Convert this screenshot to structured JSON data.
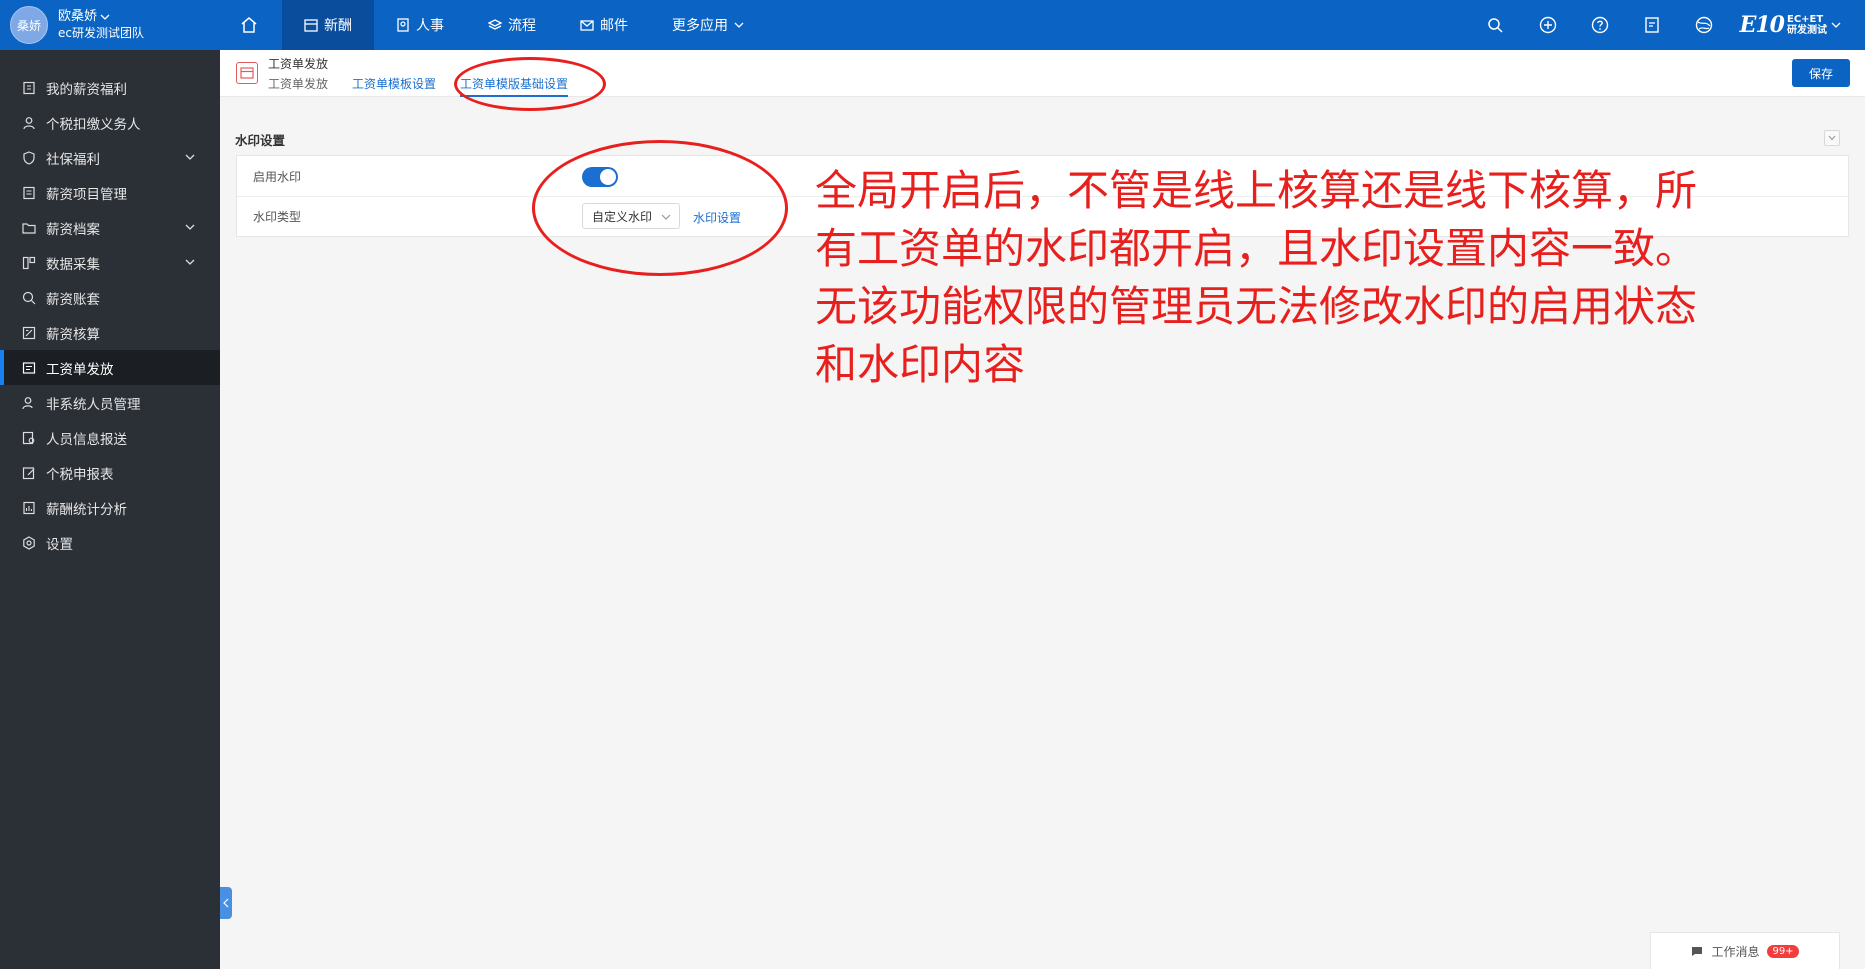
{
  "user": {
    "avatar_text": "桑娇",
    "name": "欧桑娇",
    "team": "ec研发测试团队"
  },
  "nav": {
    "items": [
      {
        "label": "新酬"
      },
      {
        "label": "人事"
      },
      {
        "label": "流程"
      },
      {
        "label": "邮件"
      },
      {
        "label": "更多应用"
      }
    ]
  },
  "brand": {
    "logo": "E10",
    "line1": "EC+ET",
    "line2": "研发测试"
  },
  "sidebar": {
    "items": [
      {
        "label": "我的薪资福利"
      },
      {
        "label": "个税扣缴义务人"
      },
      {
        "label": "社保福利"
      },
      {
        "label": "薪资项目管理"
      },
      {
        "label": "薪资档案"
      },
      {
        "label": "数据采集"
      },
      {
        "label": "薪资账套"
      },
      {
        "label": "薪资核算"
      },
      {
        "label": "工资单发放"
      },
      {
        "label": "非系统人员管理"
      },
      {
        "label": "人员信息报送"
      },
      {
        "label": "个税申报表"
      },
      {
        "label": "薪酬统计分析"
      },
      {
        "label": "设置"
      }
    ]
  },
  "header": {
    "title": "工资单发放",
    "tabs": [
      {
        "label": "工资单发放"
      },
      {
        "label": "工资单模板设置"
      },
      {
        "label": "工资单模版基础设置"
      }
    ],
    "save_label": "保存"
  },
  "section": {
    "title": "水印设置",
    "enable_label": "启用水印",
    "enable_value": true,
    "type_label": "水印类型",
    "type_value": "自定义水印",
    "settings_link": "水印设置"
  },
  "annotation": {
    "line1": "全局开启后，不管是线上核算还是线下核算，所",
    "line2": "有工资单的水印都开启，且水印设置内容一致。",
    "line3": "无该功能权限的管理员无法修改水印的启用状态",
    "line4": "和水印内容"
  },
  "messages": {
    "label": "工作消息",
    "badge": "99+"
  },
  "colors": {
    "primary": "#0b63c3",
    "sidebar_bg": "#2b2f36",
    "annotation_red": "#e8201d"
  }
}
